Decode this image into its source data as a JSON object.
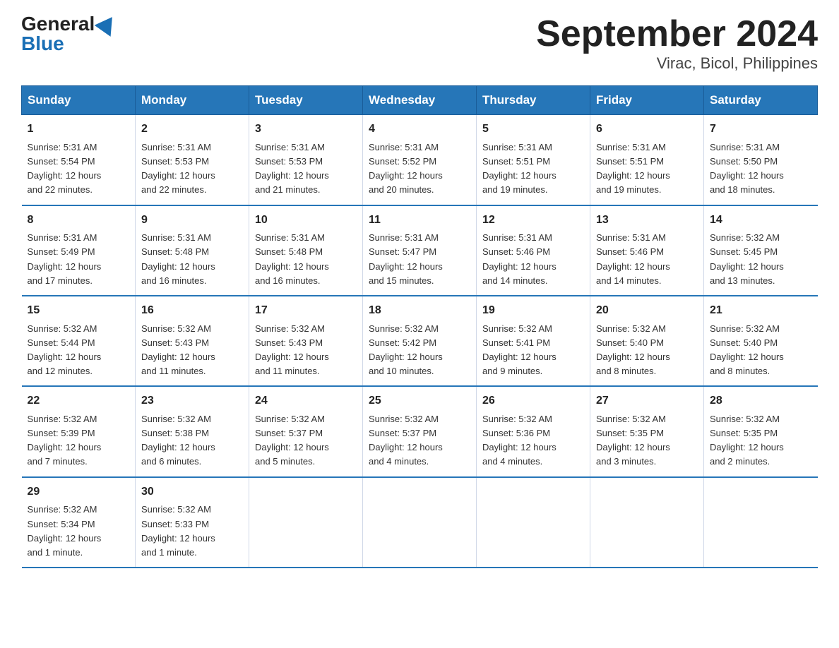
{
  "header": {
    "logo_general": "General",
    "logo_blue": "Blue",
    "title": "September 2024",
    "subtitle": "Virac, Bicol, Philippines"
  },
  "days_of_week": [
    "Sunday",
    "Monday",
    "Tuesday",
    "Wednesday",
    "Thursday",
    "Friday",
    "Saturday"
  ],
  "weeks": [
    [
      {
        "day": "1",
        "sunrise": "5:31 AM",
        "sunset": "5:54 PM",
        "daylight": "12 hours and 22 minutes."
      },
      {
        "day": "2",
        "sunrise": "5:31 AM",
        "sunset": "5:53 PM",
        "daylight": "12 hours and 22 minutes."
      },
      {
        "day": "3",
        "sunrise": "5:31 AM",
        "sunset": "5:53 PM",
        "daylight": "12 hours and 21 minutes."
      },
      {
        "day": "4",
        "sunrise": "5:31 AM",
        "sunset": "5:52 PM",
        "daylight": "12 hours and 20 minutes."
      },
      {
        "day": "5",
        "sunrise": "5:31 AM",
        "sunset": "5:51 PM",
        "daylight": "12 hours and 19 minutes."
      },
      {
        "day": "6",
        "sunrise": "5:31 AM",
        "sunset": "5:51 PM",
        "daylight": "12 hours and 19 minutes."
      },
      {
        "day": "7",
        "sunrise": "5:31 AM",
        "sunset": "5:50 PM",
        "daylight": "12 hours and 18 minutes."
      }
    ],
    [
      {
        "day": "8",
        "sunrise": "5:31 AM",
        "sunset": "5:49 PM",
        "daylight": "12 hours and 17 minutes."
      },
      {
        "day": "9",
        "sunrise": "5:31 AM",
        "sunset": "5:48 PM",
        "daylight": "12 hours and 16 minutes."
      },
      {
        "day": "10",
        "sunrise": "5:31 AM",
        "sunset": "5:48 PM",
        "daylight": "12 hours and 16 minutes."
      },
      {
        "day": "11",
        "sunrise": "5:31 AM",
        "sunset": "5:47 PM",
        "daylight": "12 hours and 15 minutes."
      },
      {
        "day": "12",
        "sunrise": "5:31 AM",
        "sunset": "5:46 PM",
        "daylight": "12 hours and 14 minutes."
      },
      {
        "day": "13",
        "sunrise": "5:31 AM",
        "sunset": "5:46 PM",
        "daylight": "12 hours and 14 minutes."
      },
      {
        "day": "14",
        "sunrise": "5:32 AM",
        "sunset": "5:45 PM",
        "daylight": "12 hours and 13 minutes."
      }
    ],
    [
      {
        "day": "15",
        "sunrise": "5:32 AM",
        "sunset": "5:44 PM",
        "daylight": "12 hours and 12 minutes."
      },
      {
        "day": "16",
        "sunrise": "5:32 AM",
        "sunset": "5:43 PM",
        "daylight": "12 hours and 11 minutes."
      },
      {
        "day": "17",
        "sunrise": "5:32 AM",
        "sunset": "5:43 PM",
        "daylight": "12 hours and 11 minutes."
      },
      {
        "day": "18",
        "sunrise": "5:32 AM",
        "sunset": "5:42 PM",
        "daylight": "12 hours and 10 minutes."
      },
      {
        "day": "19",
        "sunrise": "5:32 AM",
        "sunset": "5:41 PM",
        "daylight": "12 hours and 9 minutes."
      },
      {
        "day": "20",
        "sunrise": "5:32 AM",
        "sunset": "5:40 PM",
        "daylight": "12 hours and 8 minutes."
      },
      {
        "day": "21",
        "sunrise": "5:32 AM",
        "sunset": "5:40 PM",
        "daylight": "12 hours and 8 minutes."
      }
    ],
    [
      {
        "day": "22",
        "sunrise": "5:32 AM",
        "sunset": "5:39 PM",
        "daylight": "12 hours and 7 minutes."
      },
      {
        "day": "23",
        "sunrise": "5:32 AM",
        "sunset": "5:38 PM",
        "daylight": "12 hours and 6 minutes."
      },
      {
        "day": "24",
        "sunrise": "5:32 AM",
        "sunset": "5:37 PM",
        "daylight": "12 hours and 5 minutes."
      },
      {
        "day": "25",
        "sunrise": "5:32 AM",
        "sunset": "5:37 PM",
        "daylight": "12 hours and 4 minutes."
      },
      {
        "day": "26",
        "sunrise": "5:32 AM",
        "sunset": "5:36 PM",
        "daylight": "12 hours and 4 minutes."
      },
      {
        "day": "27",
        "sunrise": "5:32 AM",
        "sunset": "5:35 PM",
        "daylight": "12 hours and 3 minutes."
      },
      {
        "day": "28",
        "sunrise": "5:32 AM",
        "sunset": "5:35 PM",
        "daylight": "12 hours and 2 minutes."
      }
    ],
    [
      {
        "day": "29",
        "sunrise": "5:32 AM",
        "sunset": "5:34 PM",
        "daylight": "12 hours and 1 minute."
      },
      {
        "day": "30",
        "sunrise": "5:32 AM",
        "sunset": "5:33 PM",
        "daylight": "12 hours and 1 minute."
      },
      null,
      null,
      null,
      null,
      null
    ]
  ],
  "labels": {
    "sunrise": "Sunrise:",
    "sunset": "Sunset:",
    "daylight": "Daylight:"
  }
}
